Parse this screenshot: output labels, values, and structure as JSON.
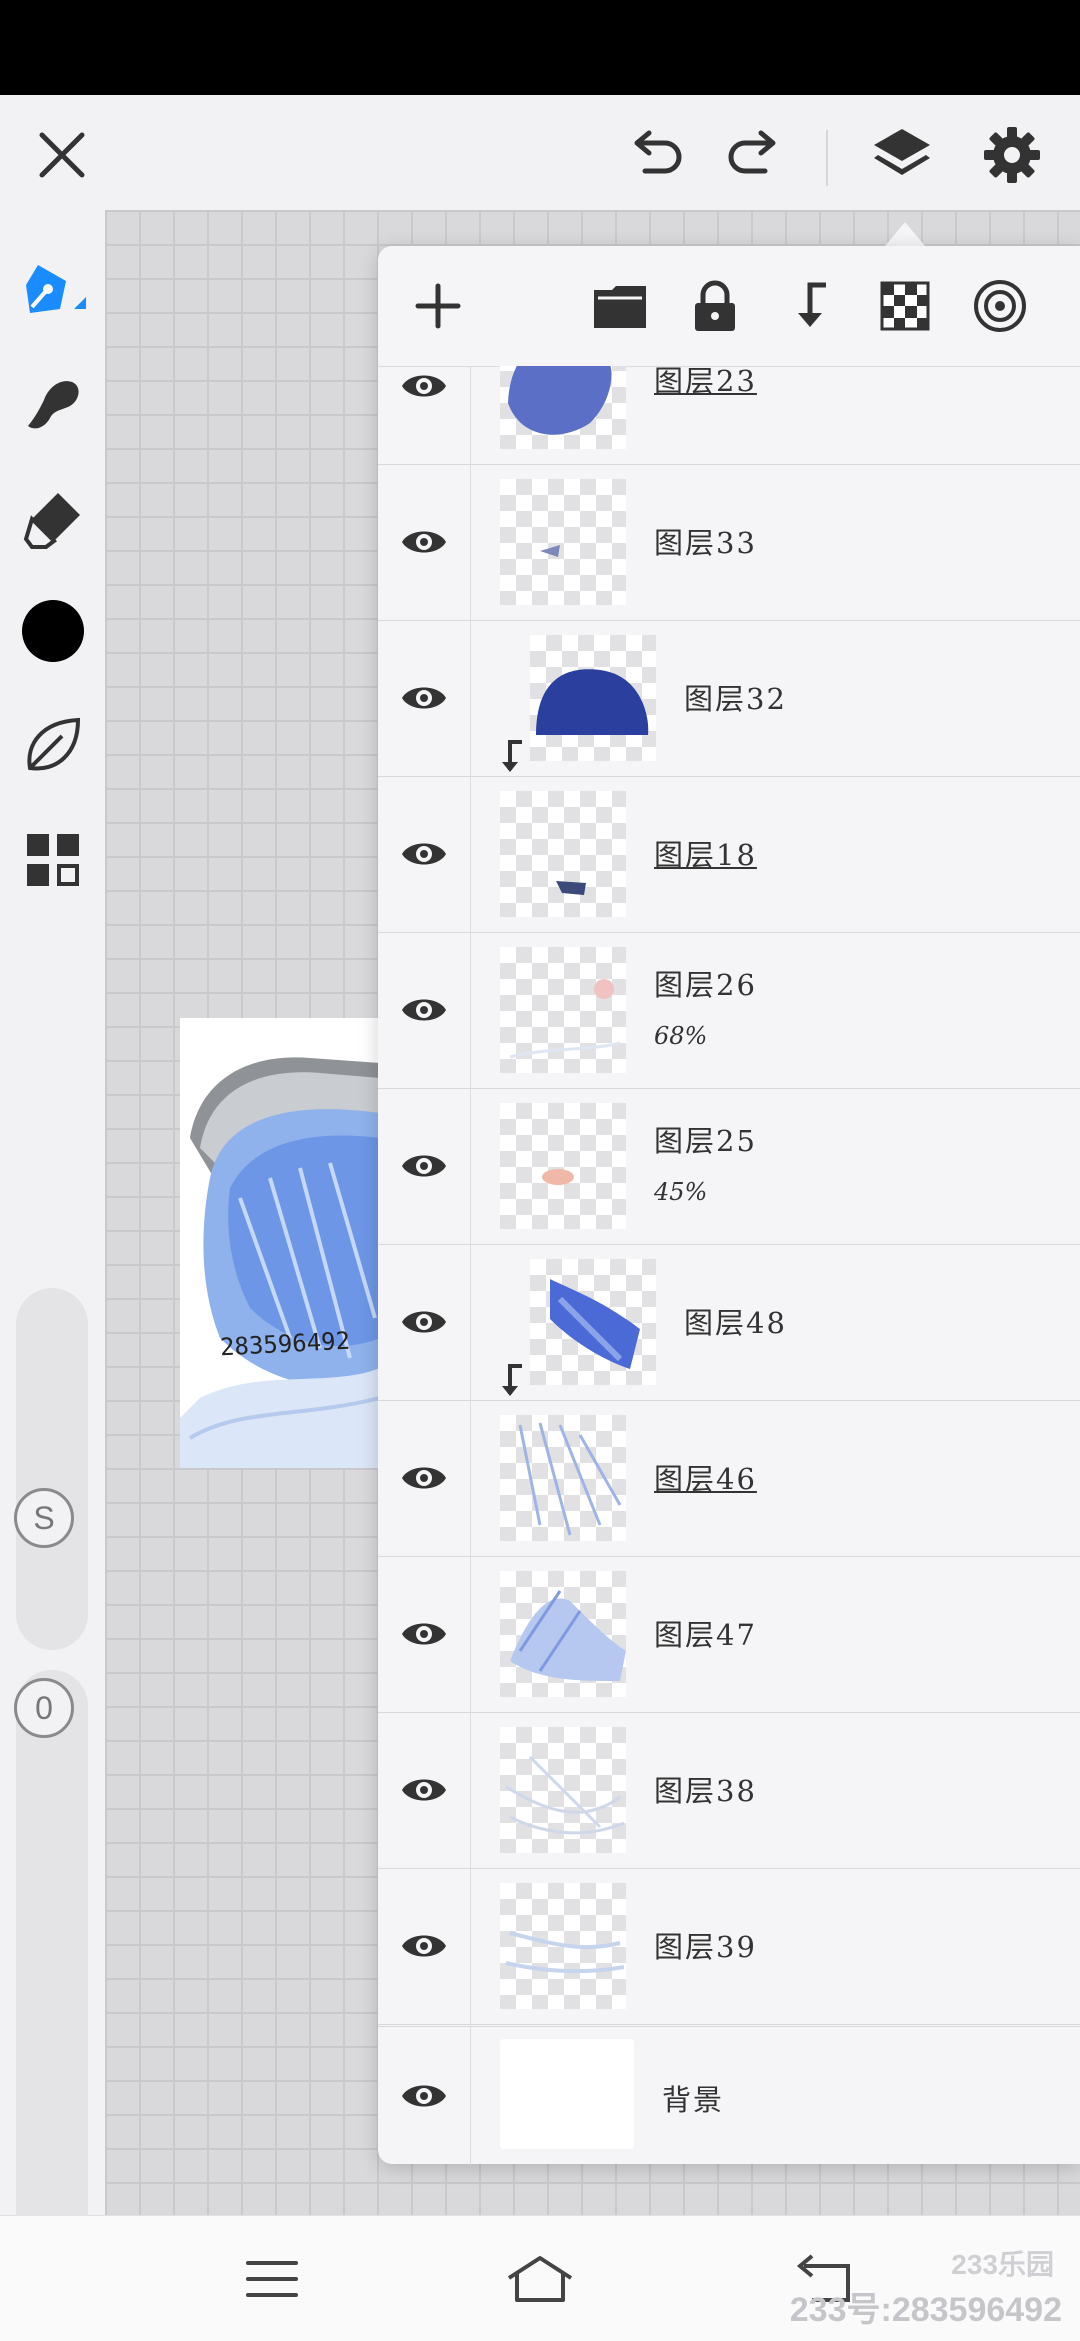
{
  "app": {
    "accent_color": "#1a8cff",
    "icons": {
      "close": "close-icon",
      "undo": "undo-icon",
      "redo": "redo-icon",
      "layers": "layers-icon",
      "settings": "gear-icon",
      "pen": "pen-icon",
      "smudge": "smudge-icon",
      "eraser": "eraser-icon",
      "color": "color-swatch",
      "leaf": "leaf-icon",
      "grid": "grid-icon"
    }
  },
  "toolbar_left": {
    "current_color": "#000000",
    "size_badge": "S",
    "opacity_badge": "0"
  },
  "artwork": {
    "signature_text": "283596492"
  },
  "layers_panel": {
    "tools": [
      "add-layer-icon",
      "folder-icon",
      "lock-icon",
      "clip-down-icon",
      "transparency-icon",
      "blend-mode-icon"
    ],
    "layers": [
      {
        "name": "图层23",
        "opacity": "",
        "underline": true,
        "clipped": false
      },
      {
        "name": "图层33",
        "opacity": "",
        "underline": false,
        "clipped": false
      },
      {
        "name": "图层32",
        "opacity": "",
        "underline": false,
        "clipped": true
      },
      {
        "name": "图层18",
        "opacity": "",
        "underline": true,
        "clipped": false
      },
      {
        "name": "图层26",
        "opacity": "68%",
        "underline": false,
        "clipped": false
      },
      {
        "name": "图层25",
        "opacity": "45%",
        "underline": false,
        "clipped": false
      },
      {
        "name": "图层48",
        "opacity": "",
        "underline": false,
        "clipped": true
      },
      {
        "name": "图层46",
        "opacity": "",
        "underline": true,
        "clipped": false
      },
      {
        "name": "图层47",
        "opacity": "",
        "underline": false,
        "clipped": false
      },
      {
        "name": "图层38",
        "opacity": "",
        "underline": false,
        "clipped": false
      },
      {
        "name": "图层39",
        "opacity": "",
        "underline": false,
        "clipped": false
      }
    ],
    "background_layer": {
      "name": "背景"
    }
  },
  "navbar": {
    "icons": [
      "menu-icon",
      "home-icon",
      "back-icon"
    ]
  },
  "watermark": {
    "logo": "233乐园",
    "text": "233号:283596492"
  }
}
